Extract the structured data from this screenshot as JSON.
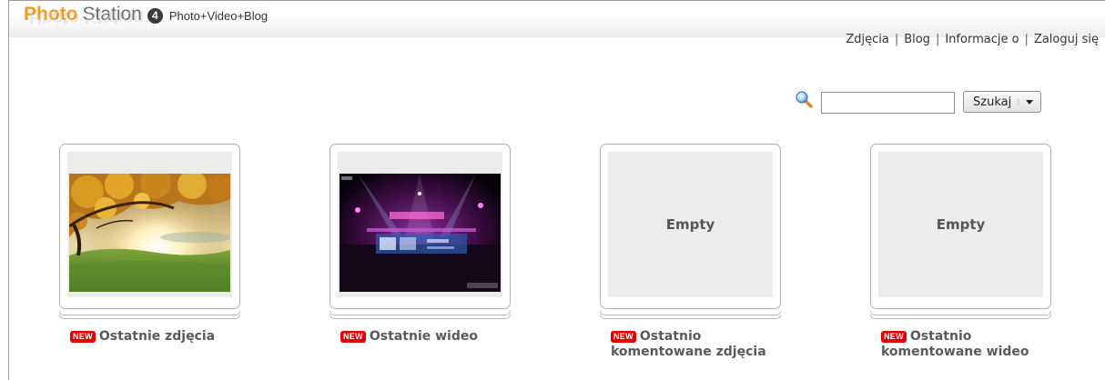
{
  "header": {
    "logo_word1": "Photo",
    "logo_word2": "Station",
    "logo_version": "4",
    "logo_tagline": "Photo+Video+Blog",
    "logo_word1_color": "#f39a1e"
  },
  "nav": {
    "items": [
      "Zdjęcia",
      "Blog",
      "Informacje o",
      "Zaloguj się"
    ],
    "separator": "|"
  },
  "search": {
    "value": "",
    "placeholder": "",
    "button_label": "Szukaj",
    "button_divider": "⁝"
  },
  "albums": [
    {
      "badge": "NEW",
      "title": "Ostatnie zdjęcia",
      "thumbnail": "autumn-tree-photo"
    },
    {
      "badge": "NEW",
      "title": "Ostatnie wideo",
      "thumbnail": "concert-stage-video"
    },
    {
      "badge": "NEW",
      "title": "Ostatnio komentowane zdjęcia",
      "empty_text": "Empty"
    },
    {
      "badge": "NEW",
      "title": "Ostatnio komentowane wideo",
      "empty_text": "Empty"
    }
  ],
  "colors": {
    "badge_red": "#e30000",
    "label_gray": "#5a5a5a"
  }
}
